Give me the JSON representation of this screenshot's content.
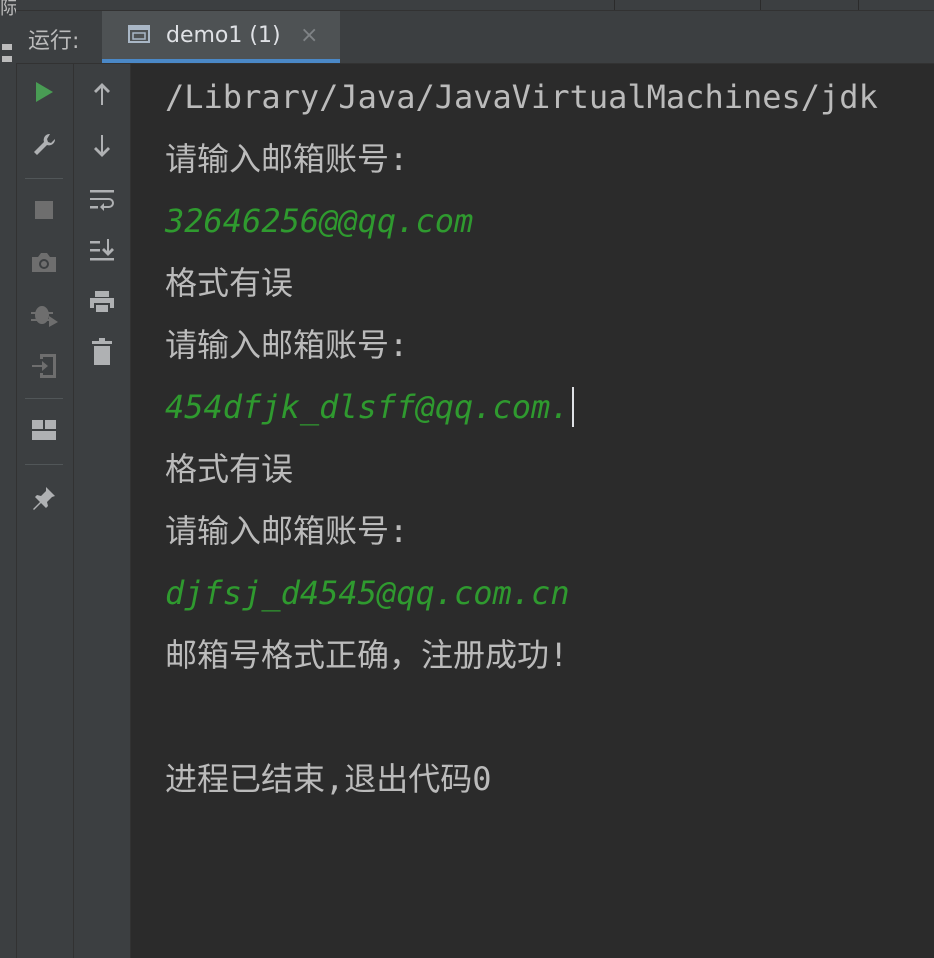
{
  "window": {
    "edge_glyph": "际"
  },
  "run_panel": {
    "label": "运行:",
    "tab": {
      "title": "demo1 (1)",
      "close_symbol": "×",
      "underline_color": "#4a88c7"
    }
  },
  "toolbar_left": {
    "items": [
      {
        "icon": "run-icon"
      },
      {
        "icon": "wrench-icon"
      },
      {
        "icon": "stop-icon"
      },
      {
        "icon": "camera-icon"
      },
      {
        "icon": "debug-bug-icon"
      },
      {
        "icon": "login-icon"
      },
      {
        "icon": "layout-icon"
      },
      {
        "icon": "pin-icon"
      }
    ]
  },
  "toolbar_right": {
    "items": [
      {
        "icon": "arrow-up-icon"
      },
      {
        "icon": "arrow-down-icon"
      },
      {
        "icon": "soft-wrap-icon"
      },
      {
        "icon": "scroll-to-end-icon"
      },
      {
        "icon": "print-icon"
      },
      {
        "icon": "trash-icon"
      }
    ]
  },
  "console": {
    "lines": [
      {
        "text": "/Library/Java/JavaVirtualMachines/jdk",
        "kind": "output"
      },
      {
        "text": "请输入邮箱账号:",
        "kind": "output"
      },
      {
        "text": "32646256@@qq.com",
        "kind": "input"
      },
      {
        "text": "格式有误",
        "kind": "output"
      },
      {
        "text": "请输入邮箱账号:",
        "kind": "output"
      },
      {
        "text": "454dfjk_dlsff@qq.com.",
        "kind": "input"
      },
      {
        "text": "格式有误",
        "kind": "output"
      },
      {
        "text": "请输入邮箱账号:",
        "kind": "output"
      },
      {
        "text": "djfsj_d4545@qq.com.cn",
        "kind": "input"
      },
      {
        "text": "邮箱号格式正确，注册成功!",
        "kind": "output"
      },
      {
        "text": "",
        "kind": "output"
      },
      {
        "text": "进程已结束,退出代码0",
        "kind": "output"
      }
    ],
    "colors": {
      "output": "#bbbbbb",
      "input": "#2f9a2f",
      "background": "#2b2b2b"
    }
  }
}
